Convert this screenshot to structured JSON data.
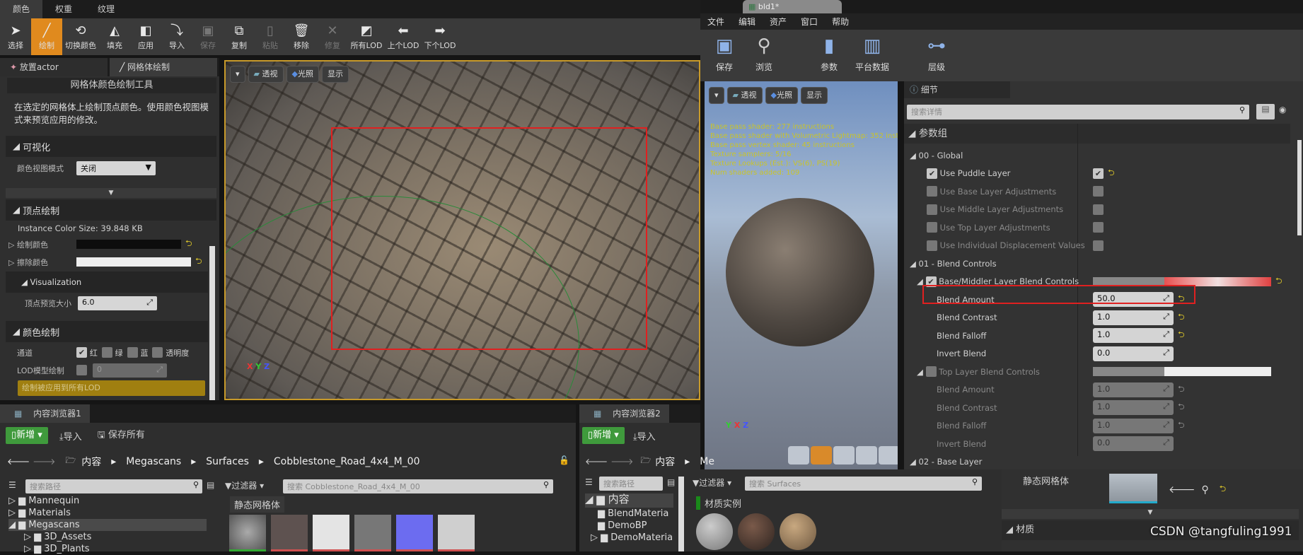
{
  "left_editor": {
    "mode_tabs": [
      "颜色",
      "权重",
      "纹理"
    ],
    "toolbar": [
      {
        "label": "选择",
        "icon": "cursor-icon"
      },
      {
        "label": "绘制",
        "icon": "brush-icon",
        "active": true
      },
      {
        "label": "切换颜色",
        "icon": "swap-color-icon"
      },
      {
        "label": "填充",
        "icon": "fill-icon"
      },
      {
        "label": "应用",
        "icon": "apply-icon"
      },
      {
        "label": "导入",
        "icon": "import-icon"
      },
      {
        "label": "保存",
        "icon": "save-icon",
        "disabled": true
      },
      {
        "label": "复制",
        "icon": "copy-icon"
      },
      {
        "label": "粘贴",
        "icon": "paste-icon",
        "disabled": true
      },
      {
        "label": "移除",
        "icon": "trash-icon"
      },
      {
        "label": "修复",
        "icon": "wrench-icon",
        "disabled": true
      },
      {
        "label": "所有LOD",
        "icon": "lod-icon"
      },
      {
        "label": "上个LOD",
        "icon": "arrow-left-icon"
      },
      {
        "label": "下个LOD",
        "icon": "arrow-right-icon"
      }
    ],
    "panel_tabs": [
      "放置actor",
      "网格体绘制"
    ],
    "panel": {
      "title": "网格体颜色绘制工具",
      "description": "在选定的网格体上绘制顶点颜色。使用颜色视图模式来预览应用的修改。",
      "visualize_section": "可视化",
      "color_view_mode_label": "颜色视图模式",
      "color_view_mode_value": "关闭",
      "vertex_paint_section": "顶点绘制",
      "instance_color_size": "Instance Color Size: 39.848 KB",
      "paint_color_label": "绘制颜色",
      "erase_color_label": "擦除颜色",
      "visualization_label": "Visualization",
      "vertex_preview_size_label": "顶点预览大小",
      "vertex_preview_size_value": "6.0",
      "color_paint_section": "颜色绘制",
      "channel_label": "通道",
      "channels": [
        {
          "label": "红",
          "checked": true
        },
        {
          "label": "绿",
          "checked": false
        },
        {
          "label": "蓝",
          "checked": false
        },
        {
          "label": "透明度",
          "checked": false
        }
      ],
      "lod_paint_label": "LOD模型绘制",
      "lod_value": "0",
      "lod_notice": "绘制被应用到所有LOD"
    },
    "viewport_buttons": [
      "透视",
      "光照",
      "显示"
    ]
  },
  "material_editor": {
    "tab_title": "bld1*",
    "menu": [
      "文件",
      "编辑",
      "资产",
      "窗口",
      "帮助"
    ],
    "toolbar": [
      {
        "label": "保存",
        "icon": "save-icon"
      },
      {
        "label": "浏览",
        "icon": "browse-icon"
      },
      {
        "label": "参数",
        "icon": "parameters-icon"
      },
      {
        "label": "平台数据",
        "icon": "platform-stats-icon"
      },
      {
        "label": "层级",
        "icon": "hierarchy-icon"
      }
    ],
    "preview_buttons": [
      "透视",
      "光照",
      "显示"
    ],
    "stats": [
      "Base pass shader: 277 instructions",
      "Base pass shader with Volumetric Lightmap: 352 instructions",
      "Base pass vertex shader: 45 instructions",
      "Texture samplers: 5/16",
      "Texture Lookups (Est.): VS(6), PS(19)",
      "Num shaders added: 109"
    ],
    "details": {
      "tab": "细节",
      "search_placeholder": "搜索详情",
      "root": "参数组",
      "rows": [
        {
          "type": "group",
          "label": "00 - Global"
        },
        {
          "type": "check",
          "label": "Use Puddle Layer",
          "checked": true,
          "enabled": true,
          "reset": true
        },
        {
          "type": "check",
          "label": "Use Base Layer Adjustments",
          "checked": false,
          "enabled": false
        },
        {
          "type": "check",
          "label": "Use Middle Layer Adjustments",
          "checked": false,
          "enabled": false
        },
        {
          "type": "check",
          "label": "Use Top Layer Adjustments",
          "checked": false,
          "enabled": false
        },
        {
          "type": "check",
          "label": "Use Individual Displacement Values",
          "checked": false,
          "enabled": false
        },
        {
          "type": "group",
          "label": "01 - Blend Controls"
        },
        {
          "type": "curve",
          "label": "Base/Middler Layer Blend Controls",
          "checked": true,
          "enabled": true,
          "reset": true
        },
        {
          "type": "value",
          "label": "Blend Amount",
          "value": "50.0",
          "enabled": true,
          "reset": true,
          "highlighted": true
        },
        {
          "type": "value",
          "label": "Blend Contrast",
          "value": "1.0",
          "enabled": true,
          "reset": true
        },
        {
          "type": "value",
          "label": "Blend Falloff",
          "value": "1.0",
          "enabled": true,
          "reset": true
        },
        {
          "type": "value",
          "label": "Invert Blend",
          "value": "0.0",
          "enabled": true
        },
        {
          "type": "curve",
          "label": "Top Layer Blend Controls",
          "checked": false,
          "enabled": false
        },
        {
          "type": "value",
          "label": "Blend Amount",
          "value": "1.0",
          "enabled": false,
          "reset": true
        },
        {
          "type": "value",
          "label": "Blend Contrast",
          "value": "1.0",
          "enabled": false,
          "reset": true
        },
        {
          "type": "value",
          "label": "Blend Falloff",
          "value": "1.0",
          "enabled": false,
          "reset": true
        },
        {
          "type": "value",
          "label": "Invert Blend",
          "value": "0.0",
          "enabled": false
        },
        {
          "type": "group",
          "label": "02 - Base Layer"
        }
      ]
    },
    "bottom": {
      "static_mesh_label": "静态网格体",
      "material_section": "材质"
    }
  },
  "content_browser_1": {
    "tab": "内容浏览器1",
    "new": "新增",
    "import": "导入",
    "save_all": "保存所有",
    "breadcrumb": [
      "内容",
      "Megascans",
      "Surfaces",
      "Cobblestone_Road_4x4_M_00"
    ],
    "path_search_placeholder": "搜索路径",
    "filter": "过滤器",
    "asset_search_placeholder": "搜索 Cobblestone_Road_4x4_M_00",
    "tree": [
      {
        "label": "Mannequin",
        "depth": 0
      },
      {
        "label": "Materials",
        "depth": 0
      },
      {
        "label": "Megascans",
        "depth": 0,
        "selected": true
      },
      {
        "label": "3D_Assets",
        "depth": 1
      },
      {
        "label": "3D_Plants",
        "depth": 1
      }
    ],
    "category": "静态网格体"
  },
  "content_browser_2": {
    "tab": "内容浏览器2",
    "new": "新增",
    "import": "导入",
    "breadcrumb": [
      "内容",
      "Me"
    ],
    "path_search_placeholder": "搜索路径",
    "filter": "过滤器",
    "asset_search_placeholder": "搜索 Surfaces",
    "tree": [
      {
        "label": "内容",
        "depth": 0
      },
      {
        "label": "BlendMateria",
        "depth": 1
      },
      {
        "label": "DemoBP",
        "depth": 1
      },
      {
        "label": "DemoMateria",
        "depth": 1
      }
    ],
    "category": "材质实例"
  },
  "watermark": "CSDN @tangfuling1991",
  "colors": {
    "accent": "#e08a1e",
    "highlight_box": "#e02020",
    "green_button": "#3f9a3c",
    "stats_text": "#c9c42a"
  }
}
